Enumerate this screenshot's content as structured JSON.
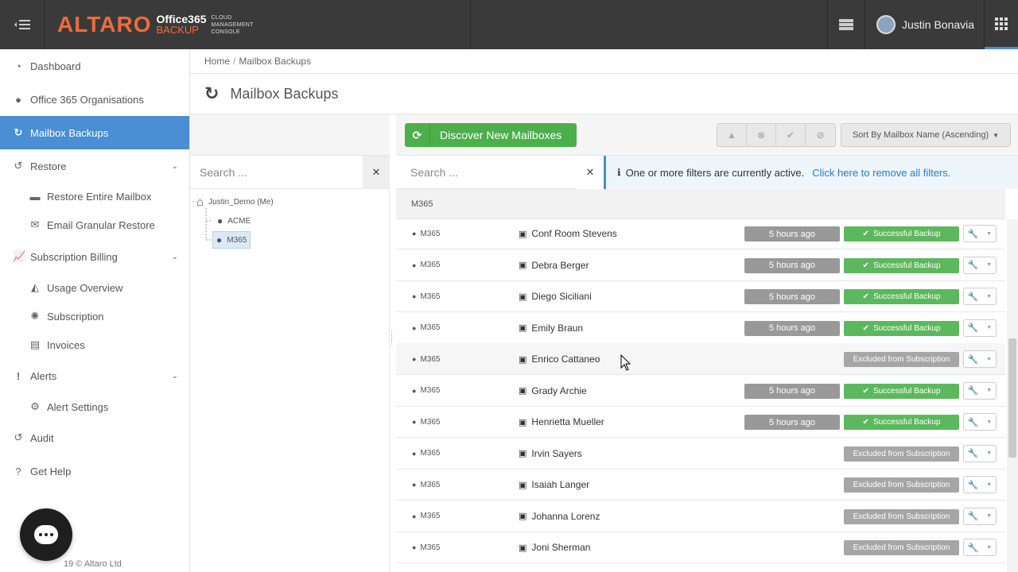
{
  "header": {
    "logo_brand": "ALTARO",
    "logo_product_line1": "Office365",
    "logo_product_line2": "BACKUP",
    "logo_sub1": "CLOUD",
    "logo_sub2": "MANAGEMENT",
    "logo_sub3": "CONSOLE",
    "user_name": "Justin Bonavia"
  },
  "sidebar": {
    "items": [
      {
        "label": "Dashboard",
        "icon": "dashboard-icon"
      },
      {
        "label": "Office 365 Organisations",
        "icon": "globe-icon"
      },
      {
        "label": "Mailbox Backups",
        "icon": "refresh-icon"
      },
      {
        "label": "Restore",
        "icon": "history-icon"
      },
      {
        "label": "Restore Entire Mailbox",
        "icon": "archive-icon"
      },
      {
        "label": "Email Granular Restore",
        "icon": "envelope-icon"
      },
      {
        "label": "Subscription Billing",
        "icon": "line-chart-icon"
      },
      {
        "label": "Usage Overview",
        "icon": "area-chart-icon"
      },
      {
        "label": "Subscription",
        "icon": "cog-icon"
      },
      {
        "label": "Invoices",
        "icon": "file-icon"
      },
      {
        "label": "Alerts",
        "icon": "exclamation-icon"
      },
      {
        "label": "Alert Settings",
        "icon": "gear-icon"
      },
      {
        "label": "Audit",
        "icon": "history-icon"
      },
      {
        "label": "Get Help",
        "icon": "question-icon"
      }
    ],
    "copyright": "19 © Altaro Ltd"
  },
  "breadcrumb": {
    "home": "Home",
    "sep": "/",
    "current": "Mailbox Backups"
  },
  "page": {
    "title": "Mailbox Backups"
  },
  "tree": {
    "search_placeholder": "Search ...",
    "root": "Justin_Demo (Me)",
    "children": [
      "ACME",
      "M365"
    ]
  },
  "toolbar": {
    "discover_label": "Discover New Mailboxes",
    "sort_label": "Sort By Mailbox Name (Ascending)"
  },
  "filter": {
    "search_placeholder": "Search ...",
    "notice_text": "One or more filters are currently active.",
    "notice_link": "Click here to remove all filters."
  },
  "group": {
    "title": "M365"
  },
  "rows": [
    {
      "org": "M365",
      "name": "Conf Room Stevens",
      "time": "5 hours ago",
      "status": "Successful Backup"
    },
    {
      "org": "M365",
      "name": "Debra Berger",
      "time": "5 hours ago",
      "status": "Successful Backup"
    },
    {
      "org": "M365",
      "name": "Diego Siciliani",
      "time": "5 hours ago",
      "status": "Successful Backup"
    },
    {
      "org": "M365",
      "name": "Emily Braun",
      "time": "5 hours ago",
      "status": "Successful Backup"
    },
    {
      "org": "M365",
      "name": "Enrico Cattaneo",
      "time": "",
      "status": "Excluded from Subscription"
    },
    {
      "org": "M365",
      "name": "Grady Archie",
      "time": "5 hours ago",
      "status": "Successful Backup"
    },
    {
      "org": "M365",
      "name": "Henrietta Mueller",
      "time": "5 hours ago",
      "status": "Successful Backup"
    },
    {
      "org": "M365",
      "name": "Irvin Sayers",
      "time": "",
      "status": "Excluded from Subscription"
    },
    {
      "org": "M365",
      "name": "Isaiah Langer",
      "time": "",
      "status": "Excluded from Subscription"
    },
    {
      "org": "M365",
      "name": "Johanna Lorenz",
      "time": "",
      "status": "Excluded from Subscription"
    },
    {
      "org": "M365",
      "name": "Joni Sherman",
      "time": "",
      "status": "Excluded from Subscription"
    }
  ],
  "colors": {
    "accent": "#4a8ed3",
    "success": "#5cb85c",
    "brand": "#f26b38",
    "topbar": "#3a3a3a"
  }
}
